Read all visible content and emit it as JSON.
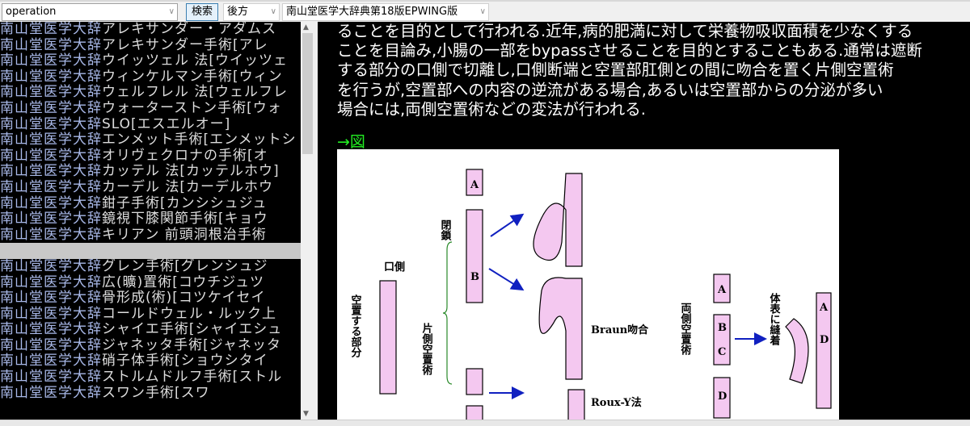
{
  "toolbar": {
    "search_value": "operation",
    "search_button": "検索",
    "direction": "後方",
    "dictionary": "南山堂医学大辞典第18版EPWING版"
  },
  "list": {
    "prefix": "南山堂医学大辞",
    "items_top": [
      "アレキサンダー・アダムス",
      "アレキサンダー手術[アレ",
      "ウイッツェル 法[ウイッツェ",
      "ウィンケルマン手術[ウィン",
      "ウェルフレル 法[ウェルフレ",
      "ウォーターストン手術[ウォ",
      "SLO[エスエルオー]",
      "エンメット手術[エンメットシ",
      "オリヴェクロナの手術[オ",
      "カッテル 法[カッテルホウ]",
      "カーデル 法[カーデルホウ",
      "鉗子手術[カンシシュジュ",
      "鏡視下膝関節手術[キョウ",
      "キリアン 前頭洞根治手術"
    ],
    "selected": "",
    "items_bottom": [
      "グレン手術[グレンシュジ",
      "広(曠)置術[コウチジュツ",
      "骨形成(術)[コツケイセイ",
      "コールドウェル・ルック上",
      "シャイエ手術[シャイエシュ",
      "ジャネッタ手術[ジャネッタ",
      "硝子体手術[ショウシタイ",
      "ストルムドルフ手術[ストル",
      "スワン手術[スワ"
    ]
  },
  "content": {
    "lines": [
      "ることを目的として行われる.近年,病的肥満に対して栄養物吸収面積を少なくする",
      "ことを目論み,小腸の一部をbypassさせることを目的とすることもある.通常は遮断",
      "する部分の口側で切離し,口側断端と空置部肛側との間に吻合を置く片側空置術",
      "を行うが,空置部への内容の逆流がある場合,あるいは空置部からの分泌が多い",
      "場合には,両側空置術などの変法が行われる."
    ],
    "figure_link": "→図",
    "figure": {
      "label_oral": "口側",
      "label_excluded": "空置する部分",
      "label_closure": "閉鎖",
      "label_unilateral": "片側空置術",
      "label_braun": "Braun吻合",
      "label_roux": "Roux-Y法",
      "label_bilateral": "両側空置術",
      "label_suture": "体表に縫着",
      "letters": [
        "A",
        "B",
        "C",
        "D"
      ]
    }
  },
  "colors": {
    "list_prefix": "#a8b8e8",
    "link": "#22ee22",
    "tube": "#f4c8f0",
    "arrow": "#1020c0"
  }
}
